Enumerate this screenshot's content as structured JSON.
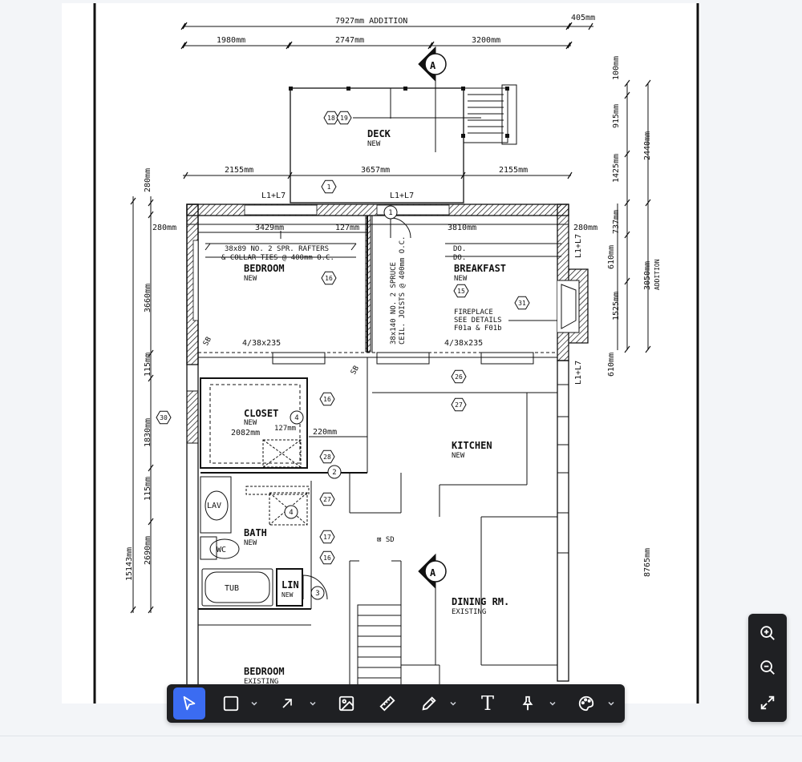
{
  "drawing": {
    "dims_top": {
      "addition": "7927mm ADDITION",
      "right": "405mm",
      "d1": "1980mm",
      "d2": "2747mm",
      "d3": "3200mm"
    },
    "dims_mid": {
      "d1": "2155mm",
      "d2": "3657mm",
      "d3": "2155mm"
    },
    "dims_right": {
      "d1": "100mm",
      "d2": "915mm",
      "d3": "1425mm",
      "d4": "2440mm",
      "d5": "737mm",
      "d6": "610mm",
      "d7": "1525mm",
      "d8": "3050mm",
      "addition": "ADDITION",
      "d9": "610mm",
      "d10": "8765mm"
    },
    "dims_left": {
      "d1": "280mm",
      "d2": "3660mm",
      "d3": "115mm",
      "d4": "1830mm",
      "d5": "115mm",
      "d6": "2690mm",
      "total": "15143mm"
    },
    "dims_inner": {
      "d1": "280mm",
      "d2": "3429mm",
      "d3": "127mm",
      "d4": "3810mm",
      "d5": "280mm",
      "d6": "2082mm",
      "d7": "127mm",
      "d8": "220mm"
    },
    "wall_labels": {
      "a": "L1+L7",
      "b": "L1+L7",
      "c": "L1+L7",
      "d": "L1+L7"
    },
    "rooms": {
      "deck": "DECK",
      "deck_sub": "NEW",
      "bedroom": "BEDROOM",
      "bedroom_sub": "NEW",
      "breakfast": "BREAKFAST",
      "breakfast_sub": "NEW",
      "closet": "CLOSET",
      "closet_sub": "NEW",
      "kitchen": "KITCHEN",
      "kitchen_sub": "NEW",
      "bath": "BATH",
      "bath_sub": "NEW",
      "dining": "DINING RM.",
      "dining_sub": "EXISTING",
      "bedroom2": "BEDROOM",
      "bedroom2_sub": "EXISTING",
      "lin": "LIN",
      "lin_sub": "NEW",
      "lav": "LAV",
      "wc": "WC",
      "tub": "TUB",
      "sd": "⊠ SD"
    },
    "notes": {
      "rafters1": "38x89 NO. 2 SPR. RAFTERS",
      "rafters2": "& COLLAR TIES @ 400mm O.C.",
      "joists1": "38x140 NO. 2 SPRUCE",
      "joists2": "CEIL. JOISTS @ 400mm O.C.",
      "do1": "DO.",
      "do2": "DO.",
      "fp1": "FIREPLACE",
      "fp2": "SEE DETAILS",
      "fp3": "F01a & F01b",
      "beam1": "4/38x235",
      "beam2": "4/38x235",
      "sb1": "SB",
      "sb2": "SB"
    },
    "tags": {
      "t18": "18",
      "t19": "19",
      "t1": "1",
      "t1b": "1",
      "t16a": "16",
      "t15": "15",
      "t31": "31",
      "t26": "26",
      "t27": "27",
      "t16b": "16",
      "t4": "4",
      "t28": "28",
      "t2": "2",
      "t27b": "27",
      "t4b": "4",
      "t17": "17",
      "t16c": "16",
      "t3": "3",
      "t30": "30"
    },
    "section": {
      "a1": "A",
      "a2": "A"
    }
  },
  "toolbar": {
    "tools": [
      {
        "name": "select",
        "icon": "cursor-icon",
        "active": true
      },
      {
        "name": "rectangle",
        "icon": "rectangle-icon"
      },
      {
        "name": "arrow",
        "icon": "arrow-icon"
      },
      {
        "name": "image",
        "icon": "image-icon"
      },
      {
        "name": "measure",
        "icon": "ruler-icon"
      },
      {
        "name": "pencil",
        "icon": "pencil-icon"
      },
      {
        "name": "text",
        "icon": "text-icon",
        "glyph": "T"
      },
      {
        "name": "pin",
        "icon": "pin-icon"
      },
      {
        "name": "color",
        "icon": "palette-icon"
      }
    ]
  },
  "zoom_controls": {
    "icons": [
      "zoom-in-icon",
      "zoom-out-icon",
      "fit-screen-icon"
    ]
  },
  "colors": {
    "toolbar_bg": "#1f2023",
    "active": "#3b6cf2",
    "canvas_bg": "#f3f5f8"
  }
}
